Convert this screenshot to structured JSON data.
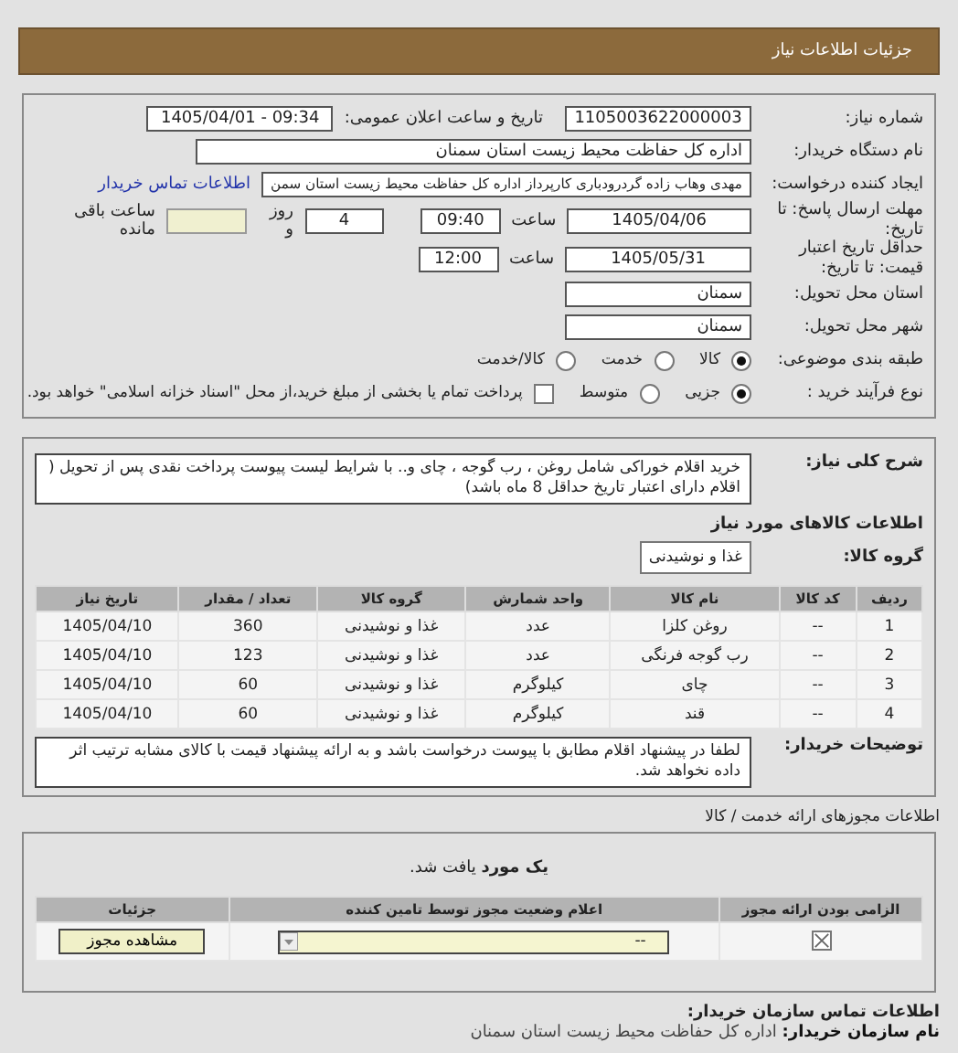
{
  "header": {
    "title": "جزئیات اطلاعات نیاز"
  },
  "need": {
    "number_label": "شماره نیاز:",
    "number": "1105003622000003",
    "announce_label": "تاریخ و ساعت اعلان عمومی:",
    "announce": "1405/04/01 - 09:34",
    "buyer_label": "نام دستگاه خریدار:",
    "buyer": "اداره کل حفاظت محیط زیست استان سمنان",
    "creator_label": "ایجاد کننده درخواست:",
    "creator": "مهدی وهاب زاده گردرودباری کارپرداز اداره کل حفاظت محیط زیست استان سمن",
    "contact_link": "اطلاعات تماس خریدار",
    "deadline_label": "مهلت ارسال پاسخ: تا تاریخ:",
    "deadline_date": "1405/04/06",
    "time_label": "ساعت",
    "deadline_time": "09:40",
    "days": "4",
    "days_label": "روز و",
    "hours_label": "ساعت باقی مانده",
    "validity_label": "حداقل تاریخ اعتبار قیمت: تا تاریخ:",
    "validity_date": "1405/05/31",
    "validity_time_label": "ساعت",
    "validity_time": "12:00",
    "province_label": "استان محل تحویل:",
    "province": "سمنان",
    "city_label": "شهر محل تحویل:",
    "city": "سمنان",
    "category_label": "طبقه بندی موضوعی:",
    "categories": [
      {
        "label": "کالا",
        "selected": true
      },
      {
        "label": "خدمت",
        "selected": false
      },
      {
        "label": "کالا/خدمت",
        "selected": false
      }
    ],
    "process_label": "نوع فرآیند خرید :",
    "processes": [
      {
        "label": "جزیی",
        "selected": true
      },
      {
        "label": "متوسط",
        "selected": false
      }
    ],
    "treasury": {
      "label": "پرداخت تمام یا بخشی از مبلغ خرید،از محل \"اسناد خزانه اسلامی\" خواهد بود.",
      "checked": false
    }
  },
  "goods": {
    "desc_label": "شرح کلی نیاز:",
    "desc": "خرید اقلام خوراکی شامل روغن ، رب گوجه ، چای و.. با شرایط لیست پیوست پرداخت نقدی پس از تحویل ( اقلام دارای اعتبار تاریخ حداقل 8 ماه باشد)",
    "heading": "اطلاعات کالاهای مورد نیاز",
    "group_label": "گروه کالا:",
    "group": "غذا و نوشیدنی",
    "columns": [
      "ردیف",
      "کد کالا",
      "نام کالا",
      "واحد شمارش",
      "گروه کالا",
      "تعداد / مقدار",
      "تاریخ نیاز"
    ],
    "rows": [
      [
        "1",
        "--",
        "روغن کلزا",
        "عدد",
        "غذا و نوشیدنی",
        "360",
        "1405/04/10"
      ],
      [
        "2",
        "--",
        "رب گوجه فرنگی",
        "عدد",
        "غذا و نوشیدنی",
        "123",
        "1405/04/10"
      ],
      [
        "3",
        "--",
        "چای",
        "کیلوگرم",
        "غذا و نوشیدنی",
        "60",
        "1405/04/10"
      ],
      [
        "4",
        "--",
        "قند",
        "کیلوگرم",
        "غذا و نوشیدنی",
        "60",
        "1405/04/10"
      ]
    ],
    "notes_label": "توضیحات خریدار:",
    "notes": "لطفا در پیشنهاد اقلام مطابق با پیوست درخواست باشد و به ارائه پیشنهاد قیمت با کالای مشابه ترتیب اثر داده نخواهد شد."
  },
  "permits": {
    "title": "اطلاعات مجوزهای ارائه خدمت / کالا",
    "found": "**یک مورد** یافت شد.",
    "columns": [
      "الزامی بودن ارائه مجوز",
      "اعلام وضعیت مجوز توسط تامین کننده",
      "جزئیات"
    ],
    "row": {
      "required": true,
      "status": "--",
      "button": "مشاهده مجوز"
    }
  },
  "contact": {
    "title": "اطلاعات تماس سازمان خریدار:",
    "org": "**نام سازمان خریدار:** اداره کل حفاظت محیط زیست استان سمنان"
  }
}
